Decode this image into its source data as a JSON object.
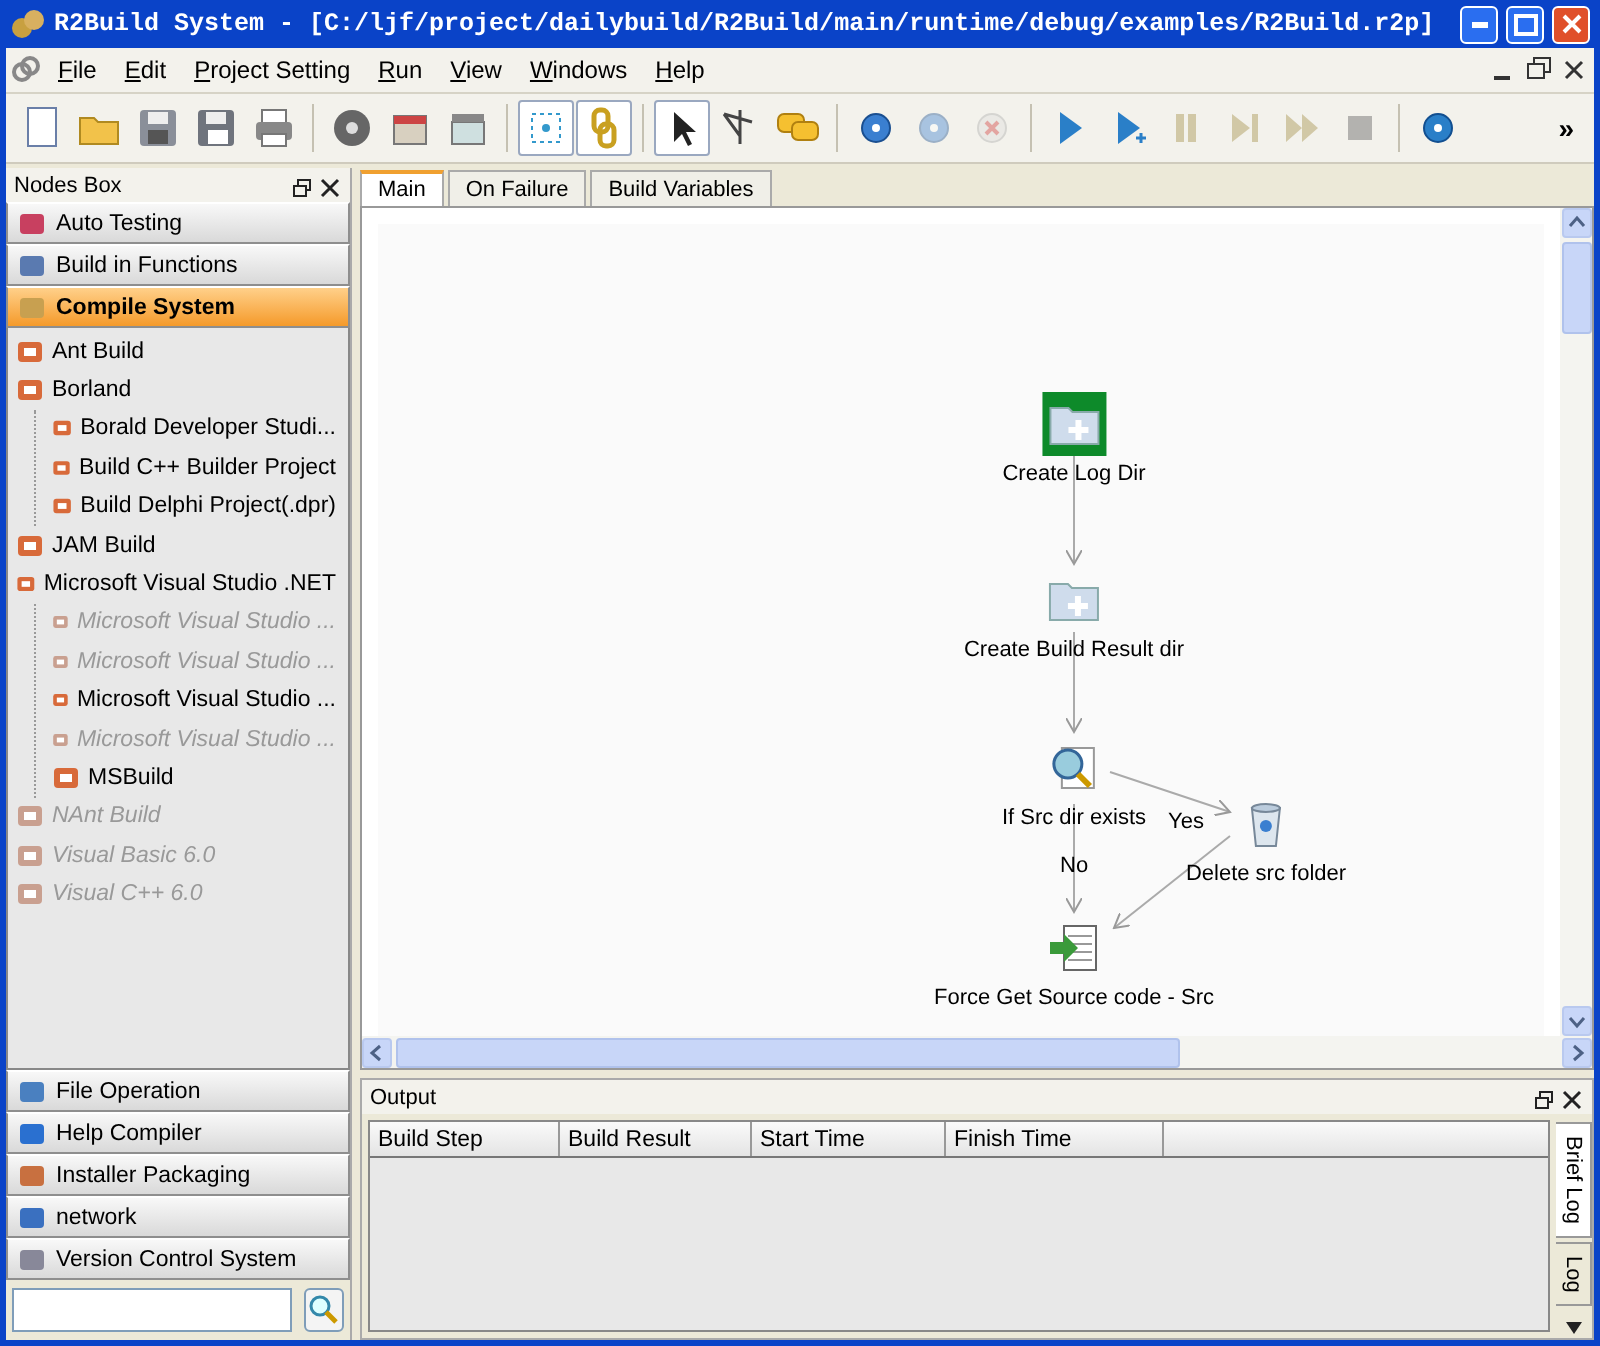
{
  "window": {
    "title": "R2Build System - [C:/ljf/project/dailybuild/R2Build/main/runtime/debug/examples/R2Build.r2p]"
  },
  "menu": [
    "File",
    "Edit",
    "Project Setting",
    "Run",
    "View",
    "Windows",
    "Help"
  ],
  "toolbar": {
    "items": [
      {
        "kind": "new",
        "pressed": false,
        "disabled": false
      },
      {
        "kind": "open",
        "pressed": false,
        "disabled": false
      },
      {
        "kind": "save",
        "pressed": false,
        "disabled": false
      },
      {
        "kind": "saveas",
        "pressed": false,
        "disabled": false
      },
      {
        "kind": "print",
        "pressed": false,
        "disabled": false
      },
      {
        "kind": "sep"
      },
      {
        "kind": "disc",
        "pressed": false,
        "disabled": false
      },
      {
        "kind": "box",
        "pressed": false,
        "disabled": false
      },
      {
        "kind": "clapper",
        "pressed": false,
        "disabled": false
      },
      {
        "kind": "sep"
      },
      {
        "kind": "fit",
        "pressed": true,
        "disabled": false
      },
      {
        "kind": "link",
        "pressed": true,
        "disabled": false
      },
      {
        "kind": "sep"
      },
      {
        "kind": "pointer",
        "pressed": true,
        "disabled": false
      },
      {
        "kind": "connector",
        "pressed": false,
        "disabled": false
      },
      {
        "kind": "comment",
        "pressed": false,
        "disabled": false
      },
      {
        "kind": "sep"
      },
      {
        "kind": "dot",
        "pressed": false,
        "disabled": false
      },
      {
        "kind": "dot",
        "pressed": false,
        "disabled": true
      },
      {
        "kind": "cross",
        "pressed": false,
        "disabled": true
      },
      {
        "kind": "sep"
      },
      {
        "kind": "play",
        "pressed": false,
        "disabled": false
      },
      {
        "kind": "stepplay",
        "pressed": false,
        "disabled": false
      },
      {
        "kind": "pause",
        "pressed": false,
        "disabled": true
      },
      {
        "kind": "step",
        "pressed": false,
        "disabled": true
      },
      {
        "kind": "fast",
        "pressed": false,
        "disabled": true
      },
      {
        "kind": "stop",
        "pressed": false,
        "disabled": true
      },
      {
        "kind": "sep"
      },
      {
        "kind": "target",
        "pressed": false,
        "disabled": false
      }
    ],
    "overflow": "»"
  },
  "nodes_box": {
    "title": "Nodes Box",
    "top_categories": [
      {
        "label": "Auto Testing",
        "selected": false
      },
      {
        "label": "Build in Functions",
        "selected": false
      },
      {
        "label": "Compile System",
        "selected": true
      }
    ],
    "tree": [
      {
        "label": "Ant Build",
        "disabled": false
      },
      {
        "label": "Borland",
        "disabled": false,
        "children": [
          {
            "label": "Borald Developer Studi...",
            "disabled": false
          },
          {
            "label": "Build C++ Builder Project",
            "disabled": false
          },
          {
            "label": "Build Delphi Project(.dpr)",
            "disabled": false
          }
        ]
      },
      {
        "label": "JAM Build",
        "disabled": false
      },
      {
        "label": "Microsoft Visual Studio .NET",
        "disabled": false,
        "children": [
          {
            "label": "Microsoft Visual Studio ...",
            "disabled": true
          },
          {
            "label": "Microsoft Visual Studio ...",
            "disabled": true
          },
          {
            "label": "Microsoft Visual Studio ...",
            "disabled": false
          },
          {
            "label": "Microsoft Visual Studio ...",
            "disabled": true
          },
          {
            "label": "MSBuild",
            "disabled": false
          }
        ]
      },
      {
        "label": "NAnt Build",
        "disabled": true
      },
      {
        "label": "Visual Basic 6.0",
        "disabled": true
      },
      {
        "label": "Visual C++ 6.0",
        "disabled": true
      }
    ],
    "bottom_categories": [
      {
        "label": "File Operation",
        "selected": false
      },
      {
        "label": "Help Compiler",
        "selected": false
      },
      {
        "label": "Installer Packaging",
        "selected": false
      },
      {
        "label": "network",
        "selected": false
      },
      {
        "label": "Version Control System",
        "selected": false
      }
    ]
  },
  "tabs": [
    {
      "label": "Main",
      "selected": true
    },
    {
      "label": "On Failure",
      "selected": false
    },
    {
      "label": "Build Variables",
      "selected": false
    }
  ],
  "diagram": {
    "nodes": [
      {
        "label": "Create Log Dir",
        "selected": true
      },
      {
        "label": "Create Build Result dir",
        "selected": false
      },
      {
        "label": "If Src dir exists",
        "selected": false,
        "branches": [
          "Yes",
          "No"
        ]
      },
      {
        "label": "Delete src folder",
        "selected": false
      },
      {
        "label": "Force Get Source code - Src",
        "selected": false
      }
    ]
  },
  "output": {
    "title": "Output",
    "columns": [
      "Build Step",
      "Build Result",
      "Start Time",
      "Finish Time"
    ],
    "side_tabs": [
      {
        "label": "Brief Log",
        "selected": true
      },
      {
        "label": "Log",
        "selected": false
      }
    ]
  }
}
